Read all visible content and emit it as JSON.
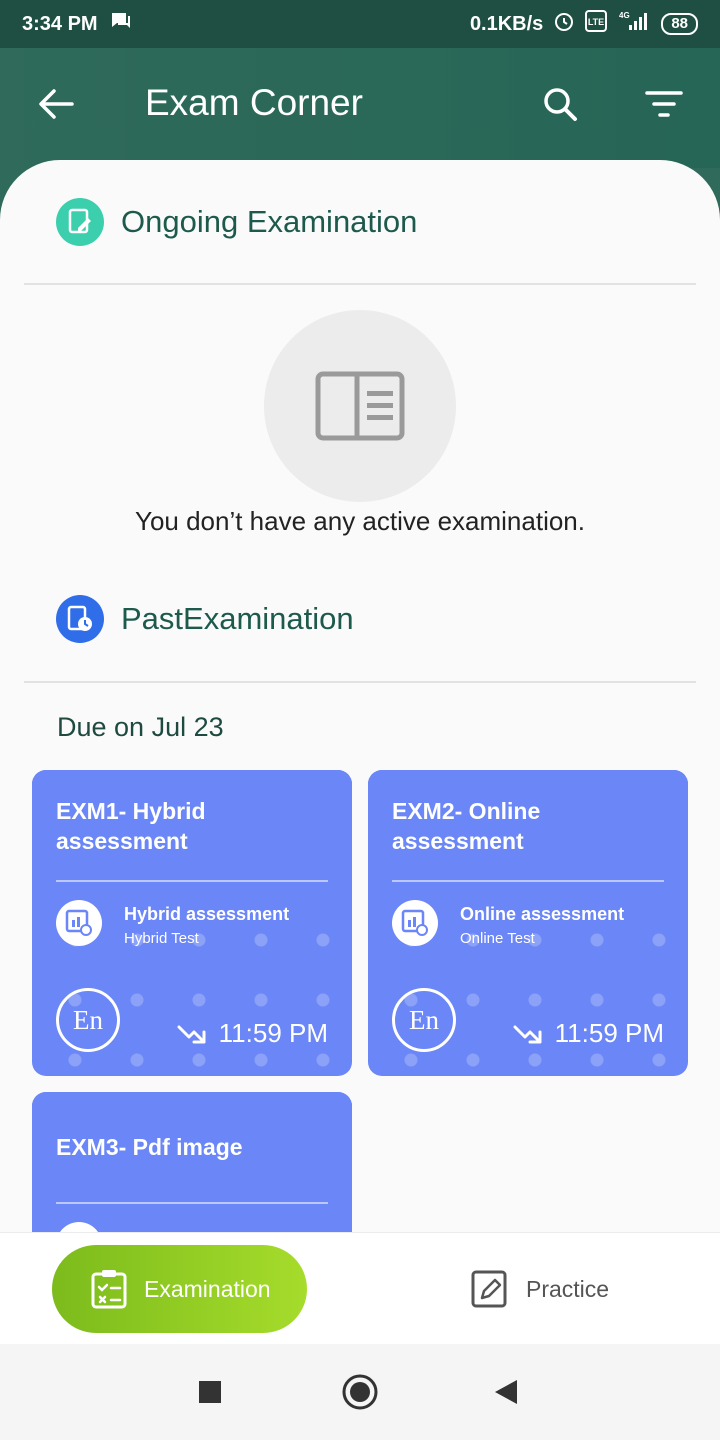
{
  "status_bar": {
    "time": "3:34 PM",
    "net_speed": "0.1KB/s",
    "network": "4G",
    "battery": "88"
  },
  "app_bar": {
    "title": "Exam Corner"
  },
  "ongoing": {
    "title": "Ongoing Examination",
    "empty_message": "You don’t have any active  examination."
  },
  "past": {
    "title": "PastExamination",
    "due_label": "Due on Jul 23"
  },
  "cards": [
    {
      "title": "EXM1- Hybrid assessment",
      "type_name": "Hybrid assessment",
      "type_sub": "Hybrid Test",
      "language": "En",
      "time": "11:59 PM"
    },
    {
      "title": "EXM2- Online assessment",
      "type_name": "Online assessment",
      "type_sub": "Online Test",
      "language": "En",
      "time": "11:59 PM"
    },
    {
      "title": "EXM3- Pdf image"
    }
  ],
  "bottom_nav": {
    "examination": "Examination",
    "practice": "Practice"
  },
  "colors": {
    "header": "#2f6a5a",
    "card": "#6b86f6",
    "accent_green": "#8cc820",
    "ongoing_icon": "#3ccfae",
    "past_icon": "#2f6ee8"
  }
}
